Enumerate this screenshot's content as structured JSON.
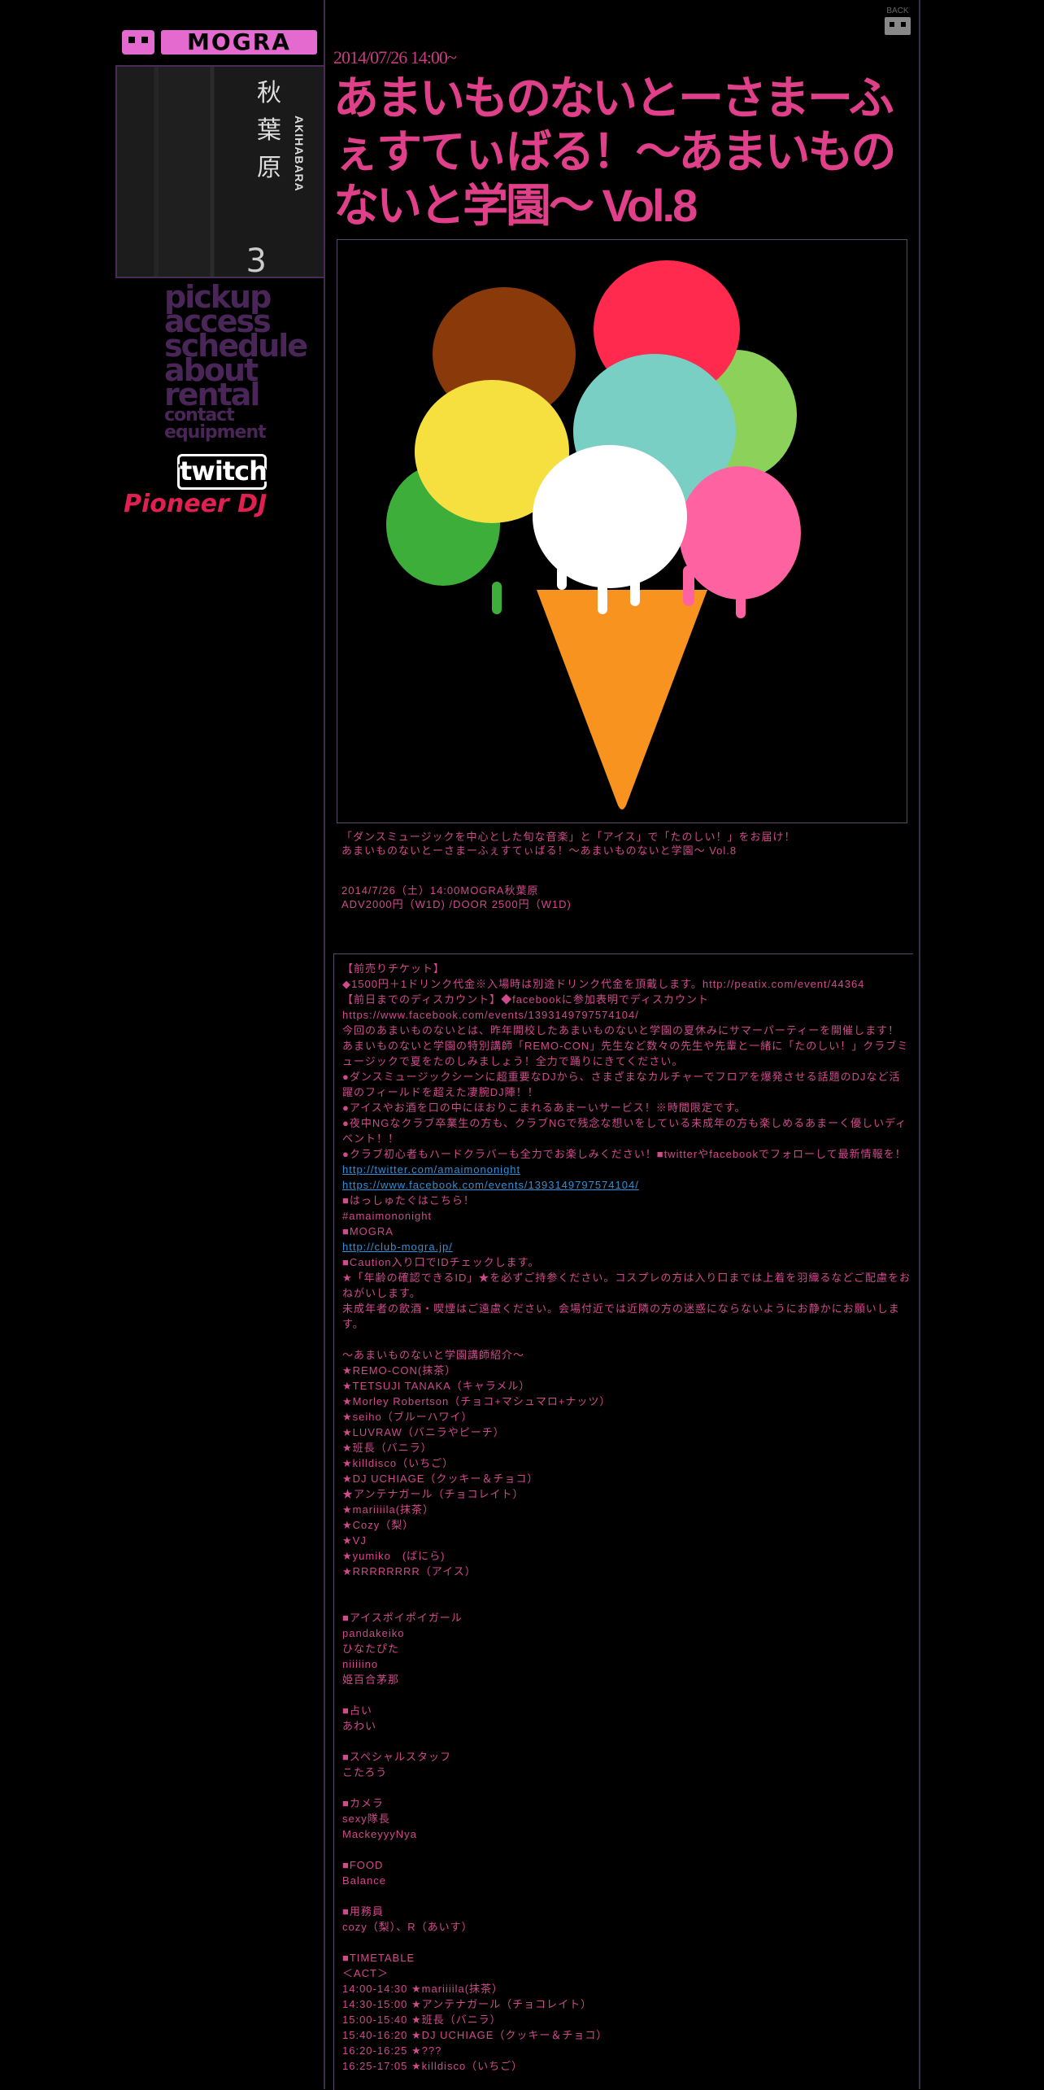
{
  "sidebar": {
    "logo_text": "MOGRA",
    "photo": {
      "sign": "秋葉原",
      "sub": "AKIHABARA",
      "number": "3"
    },
    "nav": [
      {
        "label": "pickup",
        "size": "big"
      },
      {
        "label": "access",
        "size": "big"
      },
      {
        "label": "schedule",
        "size": "big"
      },
      {
        "label": "about",
        "size": "big"
      },
      {
        "label": "rental",
        "size": "big"
      },
      {
        "label": "contact",
        "size": "small"
      },
      {
        "label": "equipment",
        "size": "small"
      }
    ],
    "twitch": "twitch",
    "pioneer": "Pioneer DJ"
  },
  "header": {
    "back": "BACK"
  },
  "event": {
    "date": "2014/07/26 14:00~",
    "title": "あまいものないとーさまーふぇすてぃばる！～あまいものないと学園～ Vol.8",
    "intro": "「ダンスミュージックを中心とした旬な音楽」と「アイス」で「たのしい！」をお届け！\nあまいものないとーさまーふぇすてぃばる！～あまいものないと学園～ Vol.8",
    "info": "2014/7/26（土）14:00MOGRA秋葉原\nADV2000円（W1D) /DOOR 2500円（W1D)"
  },
  "body": {
    "block1": "【前売りチケット】\n◆1500円＋1ドリンク代金※入場時は別途ドリンク代金を頂戴します。http://peatix.com/event/44364\n【前日までのディスカウント】◆facebookに参加表明でディスカウント\nhttps://www.facebook.com/events/1393149797574104/\n今回のあまいものないとは、昨年開校したあまいものないと学園の夏休みにサマーパーティーを開催します！\nあまいものないと学園の特別講師「REMO-CON」先生など数々の先生や先輩と一緒に「たのしい！」クラブミュージックで夏をたのしみましょう！全力で踊りにきてください。\n●ダンスミュージックシーンに超重要なDJから、さまざまなカルチャーでフロアを爆発させる話題のDJなど活躍のフィールドを超えた凄腕DJ陣！！\n●アイスやお酒を口の中にほおりこまれるあまーいサービス！※時間限定です。\n●夜中NGなクラブ卒業生の方も、クラブNGで残念な想いをしている未成年の方も楽しめるあまーく優しいディベント！！\n●クラブ初心者もハードクラバーも全力でお楽しみください！■twitterやfacebookでフォローして最新情報を！",
    "link1": "http://twitter.com/amaimononight",
    "link2": "https://www.facebook.com/events/1393149797574104/",
    "block2": "■はっしゅたぐはこちら！\n#amaimononight\n■MOGRA",
    "link3": "http://club-mogra.jp/",
    "block3": "■Caution入り口でIDチェックします。\n★「年齢の確認できるID」★を必ずご持参ください。コスプレの方は入り口までは上着を羽織るなどご配慮をおねがいします。\n未成年者の飲酒・喫煙はご遠慮ください。会場付近では近隣の方の迷惑にならないようにお静かにお願いします。\n\n～あまいものないと学園講師紹介～\n★REMO-CON(抹茶）\n★TETSUJI TANAKA（キャラメル）\n★Morley Robertson（チョコ+マシュマロ+ナッツ）\n★seiho（ブルーハワイ）\n★LUVRAW（バニラやピーチ）\n★班長（バニラ）\n★killdisco（いちご）\n★DJ UCHIAGE（クッキー＆チョコ）\n★アンテナガール（チョコレイト）\n★mariiiila(抹茶）\n★Cozy（梨）\n★VJ\n★yumiko　(ばにら)\n★RRRRRRRR（アイス）\n\n\n■アイスポイポイガール\npandakeiko\nひなたぴた\nniiiiino\n姫百合茅那\n\n■占い\nあわい\n\n■スペシャルスタッフ\nこたろう\n\n■カメラ\nsexy隊長\nMackeyyyNya\n\n■FOOD\nBalance\n\n■用務員\ncozy（梨）、R（あいす）\n\n■TIMETABLE\n＜ACT＞\n14:00-14:30 ★mariiiila(抹茶）\n14:30-15:00 ★アンテナガール（チョコレイト）\n15:00-15:40 ★班長（バニラ）\n15:40-16:20 ★DJ UCHIAGE（クッキー＆チョコ）\n16:20-16:25 ★???\n16:25-17:05 ★killdisco（いちご）"
  },
  "colors": {
    "accent": "#e0408a",
    "nav": "#4a2658",
    "link": "#2f8fd8",
    "frame": "#3a2f45"
  }
}
